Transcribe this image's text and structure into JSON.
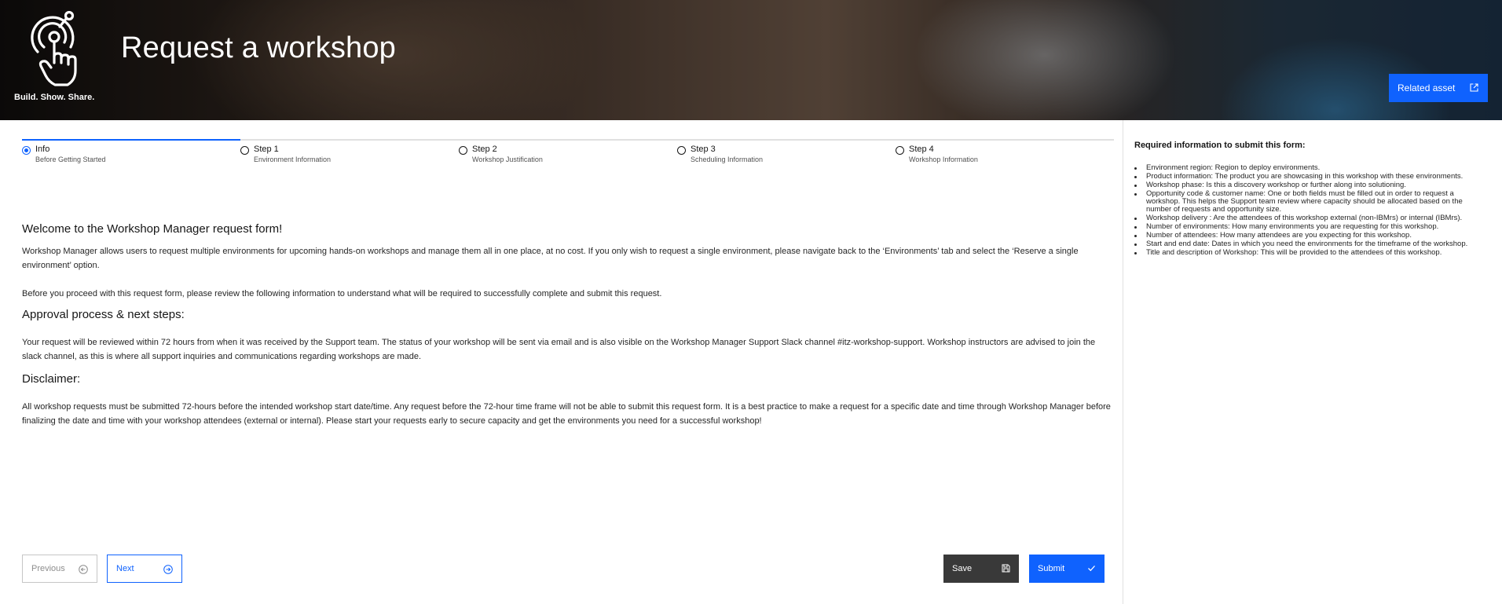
{
  "header": {
    "logo_tagline": "Build. Show. Share.",
    "title": "Request a workshop",
    "related_asset_label": "Related asset"
  },
  "progress": {
    "steps": [
      {
        "label": "Info",
        "sublabel": "Before Getting Started",
        "state": "current"
      },
      {
        "label": "Step 1",
        "sublabel": "Environment Information",
        "state": "incomplete"
      },
      {
        "label": "Step 2",
        "sublabel": "Workshop Justification",
        "state": "incomplete"
      },
      {
        "label": "Step 3",
        "sublabel": "Scheduling Information",
        "state": "incomplete"
      },
      {
        "label": "Step 4",
        "sublabel": "Workshop Information",
        "state": "incomplete"
      }
    ]
  },
  "content": {
    "welcome_heading": "Welcome to the Workshop Manager request form!",
    "intro_paragraph": "Workshop Manager allows users to request multiple environments for upcoming hands-on workshops and manage them all in one place, at no cost. If you only wish to request a single environment, please navigate back to the ‘Environments’ tab and select the ‘Reserve a single environment’ option.",
    "review_paragraph": "Before you proceed with this request form, please review the following information to understand what will be required to successfully complete and submit this request.",
    "approval_heading": "Approval process & next steps:",
    "approval_paragraph": "Your request will be reviewed within 72 hours from when it was received by the Support team. The status of your workshop will be sent via email and is also visible on the Workshop Manager Support Slack channel #itz-workshop-support. Workshop instructors are advised to join the slack channel, as this is where all support inquiries and communications regarding workshops are made.",
    "disclaimer_heading": "Disclaimer:",
    "disclaimer_paragraph": "All workshop requests must be submitted 72-hours before the intended workshop start date/time. Any request before the 72-hour time frame will not be able to submit this request form. It is a best practice to make a request for a specific date and time through Workshop Manager before finalizing the date and time with your workshop attendees (external or internal). Please start your requests early to secure capacity and get the environments you need for a successful workshop!"
  },
  "buttons": {
    "previous": "Previous",
    "next": "Next",
    "save": "Save",
    "submit": "Submit"
  },
  "side_panel": {
    "title": "Required information to submit this form:",
    "items": [
      "Environment region: Region to deploy environments.",
      "Product information: The product you are showcasing in this workshop with these environments.",
      "Workshop phase: Is this a discovery workshop or further along into solutioning.",
      "Opportunity code & customer name: One or both fields must be filled out in order to request a workshop. This helps the Support team review where capacity should be allocated based on the number of requests and opportunity size.",
      "Workshop delivery : Are the attendees of this workshop external (non-IBMrs) or internal (IBMrs).",
      "Number of environments: How many environments you are requesting for this workshop.",
      "Number of attendees: How many attendees are you expecting for this workshop.",
      "Start and end date: Dates in which you need the environments for the timeframe of the workshop.",
      "Title and description of Workshop: This will be provided to the attendees of this workshop."
    ]
  },
  "colors": {
    "primary": "#0f62fe",
    "save_button": "#393939",
    "text": "#161616"
  },
  "icons": {
    "logo": "touch-hand-icon",
    "related_asset": "launch-icon",
    "previous": "arrow-left-circle-icon",
    "next": "arrow-right-circle-icon",
    "save": "save-icon",
    "submit": "checkmark-icon"
  }
}
